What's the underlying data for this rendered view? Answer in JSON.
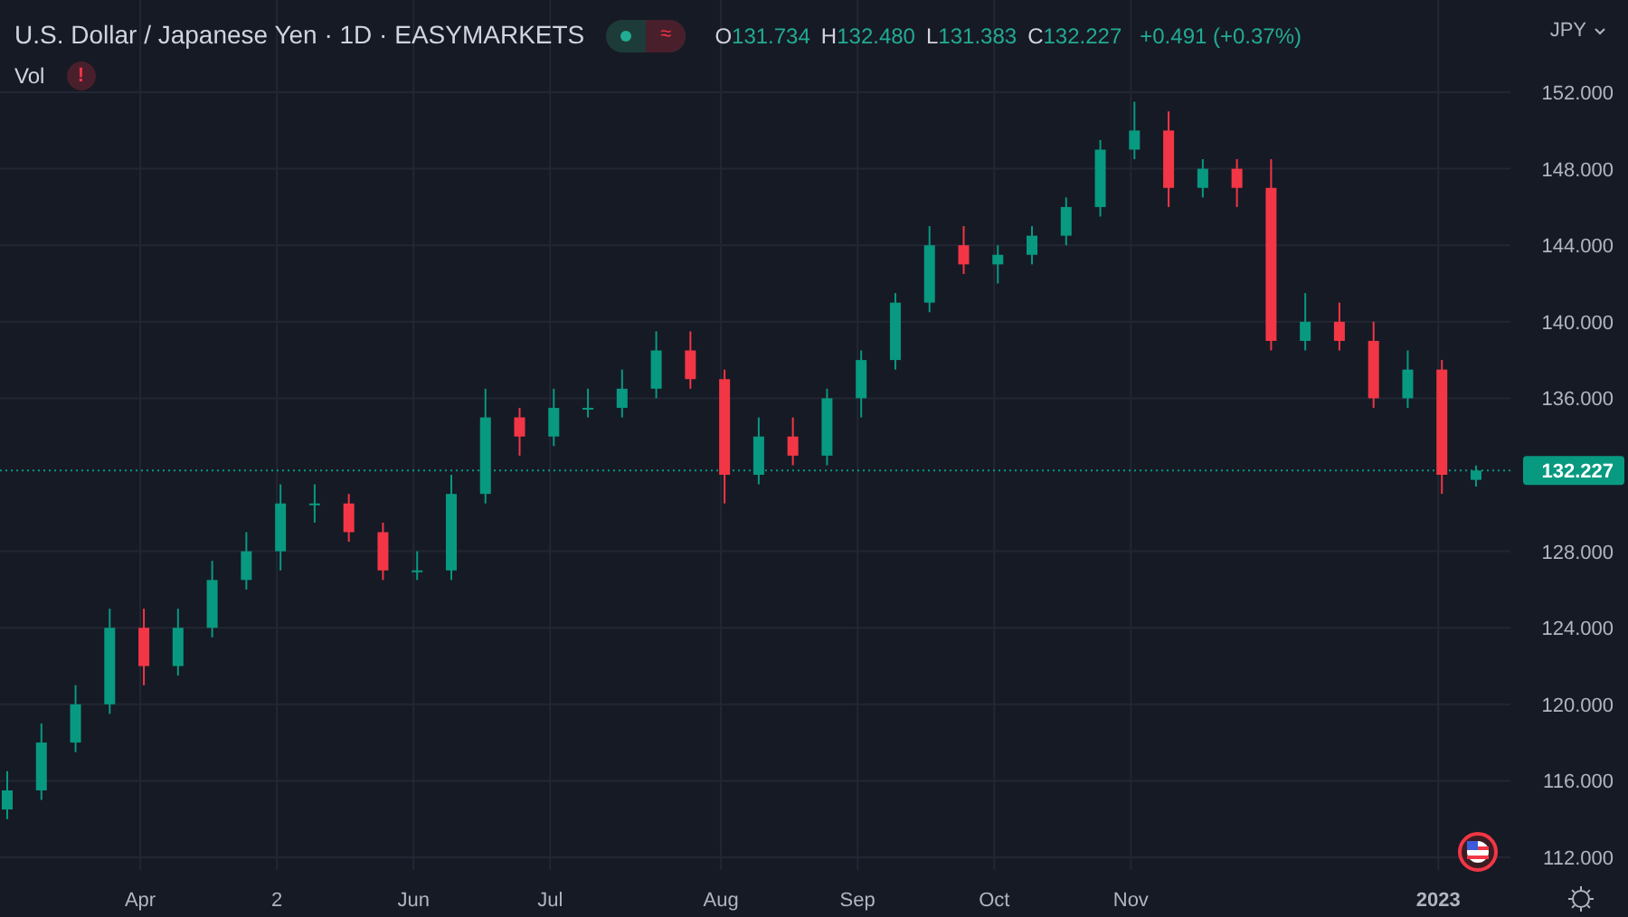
{
  "header": {
    "title": "U.S. Dollar / Japanese Yen · 1D · EASYMARKETS",
    "status_badge": "≈",
    "ohlc": [
      {
        "label": "O",
        "value": "131.734"
      },
      {
        "label": "H",
        "value": "132.480"
      },
      {
        "label": "L",
        "value": "131.383"
      },
      {
        "label": "C",
        "value": "132.227"
      }
    ],
    "change": "+0.491 (+0.37%)",
    "currency": "JPY"
  },
  "indicator": {
    "name": "Vol",
    "alert": "!"
  },
  "chart_data": {
    "type": "candlestick",
    "grid": true,
    "ref_lines": [
      {
        "axis": "y",
        "value": 132.227,
        "label": "132.227",
        "color": "#089981",
        "line_style": "dotted"
      }
    ],
    "yticks": [
      {
        "value": 112,
        "label": "112.000"
      },
      {
        "value": 116,
        "label": "116.000"
      },
      {
        "value": 120,
        "label": "120.000"
      },
      {
        "value": 124,
        "label": "124.000"
      },
      {
        "value": 128,
        "label": "128.000"
      },
      {
        "value": 136,
        "label": "136.000"
      },
      {
        "value": 140,
        "label": "140.000"
      },
      {
        "value": 144,
        "label": "144.000"
      },
      {
        "value": 148,
        "label": "148.000"
      },
      {
        "value": 152,
        "label": "152.000"
      }
    ],
    "ylim": [
      112,
      152
    ],
    "categories": [
      null,
      null,
      null,
      null,
      "Apr",
      null,
      null,
      null,
      "2",
      null,
      null,
      null,
      "Jun",
      null,
      null,
      null,
      "Jul",
      null,
      null,
      null,
      null,
      "Aug",
      null,
      null,
      null,
      "Sep",
      null,
      null,
      null,
      "Oct",
      null,
      null,
      null,
      "Nov",
      null,
      null,
      null,
      null,
      null,
      null,
      null,
      null,
      "2023",
      null
    ],
    "ohlc": [
      [
        114.5,
        116.5,
        114,
        115.5
      ],
      [
        115.5,
        119,
        115,
        118
      ],
      [
        118,
        121,
        117.5,
        120
      ],
      [
        120,
        125,
        119.5,
        124
      ],
      [
        124,
        125,
        121,
        122
      ],
      [
        122,
        125,
        121.5,
        124
      ],
      [
        124,
        127.5,
        123.5,
        126.5
      ],
      [
        126.5,
        129,
        126,
        128
      ],
      [
        128,
        131.5,
        127,
        130.5
      ],
      [
        130.5,
        131.5,
        129.5,
        130.5
      ],
      [
        130.5,
        131,
        128.5,
        129
      ],
      [
        129,
        129.5,
        126.5,
        127
      ],
      [
        127,
        128,
        126.5,
        127
      ],
      [
        127,
        132,
        126.5,
        131
      ],
      [
        131,
        136.5,
        130.5,
        135
      ],
      [
        135,
        135.5,
        133,
        134
      ],
      [
        134,
        136.5,
        133.5,
        135.5
      ],
      [
        135.5,
        136.5,
        135,
        135.5
      ],
      [
        135.5,
        137.5,
        135,
        136.5
      ],
      [
        136.5,
        139.5,
        136,
        138.5
      ],
      [
        138.5,
        139.5,
        136.5,
        137
      ],
      [
        137,
        137.5,
        130.5,
        132
      ],
      [
        132,
        135,
        131.5,
        134
      ],
      [
        134,
        135,
        132.5,
        133
      ],
      [
        133,
        136.5,
        132.5,
        136
      ],
      [
        136,
        138.5,
        135,
        138
      ],
      [
        138,
        141.5,
        137.5,
        141
      ],
      [
        141,
        145,
        140.5,
        144
      ],
      [
        144,
        145,
        142.5,
        143
      ],
      [
        143,
        144,
        142,
        143.5
      ],
      [
        143.5,
        145,
        143,
        144.5
      ],
      [
        144.5,
        146.5,
        144,
        146
      ],
      [
        146,
        149.5,
        145.5,
        149
      ],
      [
        149,
        151.5,
        148.5,
        150
      ],
      [
        150,
        151,
        146,
        147
      ],
      [
        147,
        148.5,
        146.5,
        148
      ],
      [
        148,
        148.5,
        146,
        147
      ],
      [
        147,
        148.5,
        138.5,
        139
      ],
      [
        139,
        141.5,
        138.5,
        140
      ],
      [
        140,
        141,
        138.5,
        139
      ],
      [
        139,
        140,
        135.5,
        136
      ],
      [
        136,
        138.5,
        135.5,
        137.5
      ],
      [
        137.5,
        138,
        131,
        132
      ],
      [
        131.734,
        132.48,
        131.383,
        132.227
      ]
    ]
  }
}
